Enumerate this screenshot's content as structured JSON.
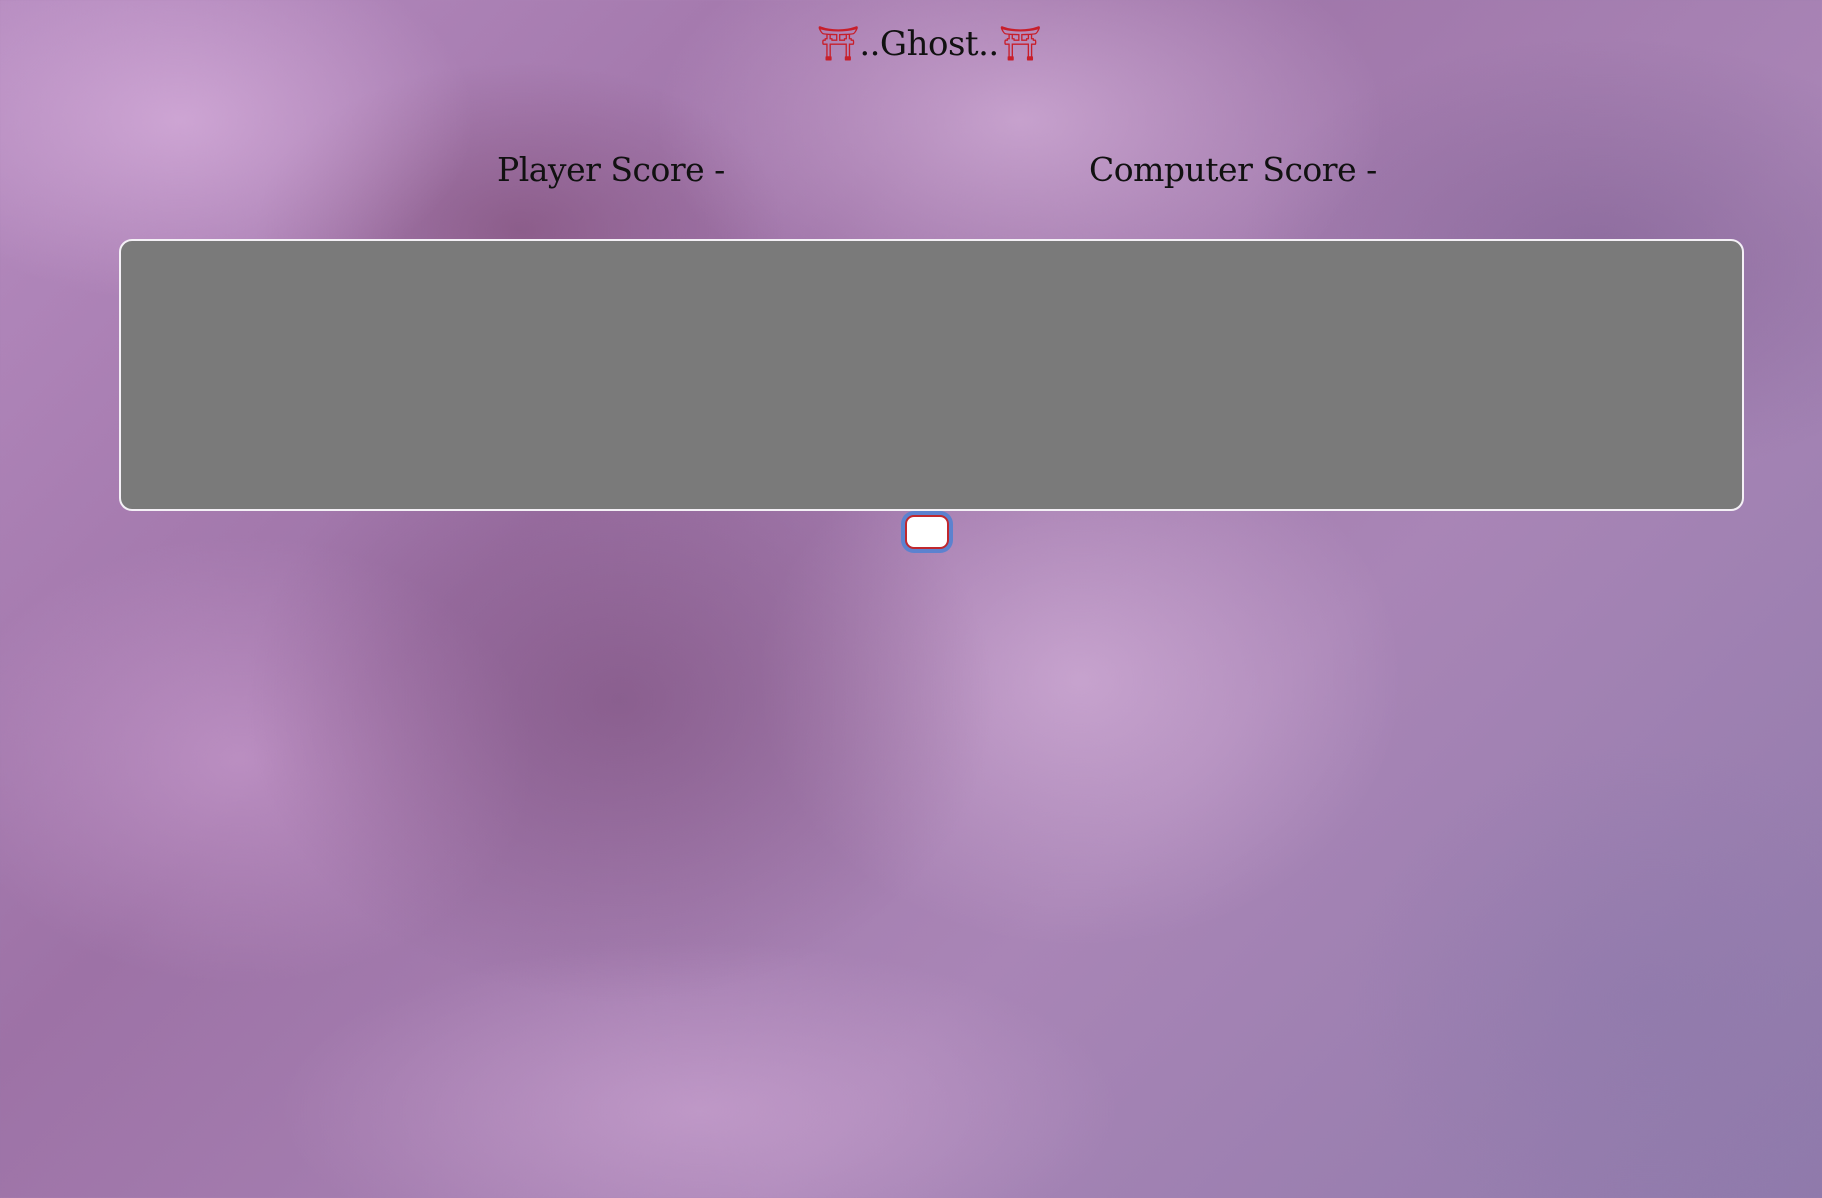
{
  "header": {
    "title_prefix_icon": "⛩",
    "title": "..Ghost..",
    "title_suffix_icon": "⛩"
  },
  "scores": {
    "player_label": "Player Score -",
    "computer_label": "Computer Score -"
  },
  "board": {
    "content": ""
  },
  "input": {
    "value": "",
    "placeholder": ""
  },
  "colors": {
    "board_background": "#7a7a7a",
    "torii_red": "#c81e2a",
    "input_border": "#c0282e",
    "focus_ring": "#5c82cf"
  },
  "icons": {
    "title_left": "torii-gate-icon",
    "title_right": "torii-gate-icon"
  }
}
